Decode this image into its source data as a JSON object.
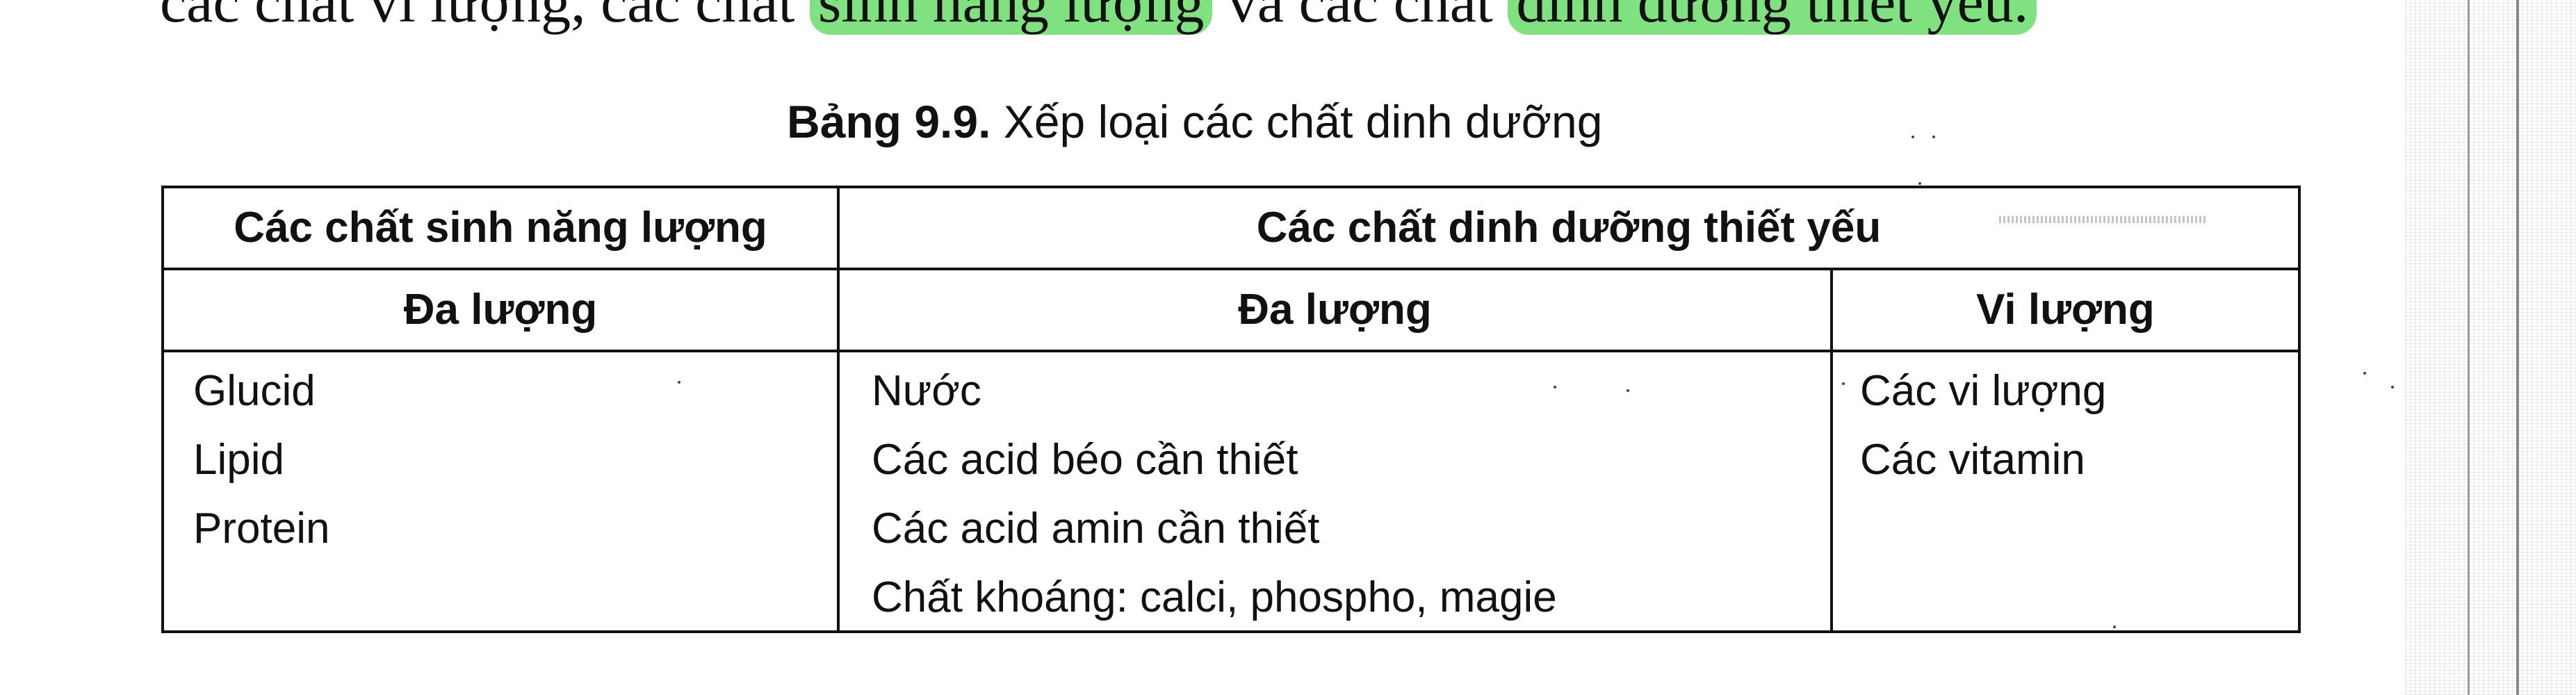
{
  "body_text": {
    "before_highlight_1": "các chất vi lượng, các chất ",
    "highlight_1": "sinh năng lượng",
    "between": " và các chất ",
    "highlight_2": "dinh dưỡng thiết yếu."
  },
  "caption": {
    "label": "Bảng 9.9.",
    "title": " Xếp loại các chất dinh dưỡng"
  },
  "table": {
    "group_headers": [
      "Các chất sinh năng lượng",
      "Các chất dinh dưỡng thiết yếu"
    ],
    "sub_headers": [
      "Đa lượng",
      "Đa lượng",
      "Vi lượng"
    ],
    "columns": [
      [
        "Glucid",
        "Lipid",
        "Protein"
      ],
      [
        "Nước",
        "Các acid béo cần thiết",
        "Các acid amin cần thiết",
        "Chất khoáng: calci, phospho, magie"
      ],
      [
        "Các vi lượng",
        "Các vitamin"
      ]
    ]
  },
  "colors": {
    "highlight": "#7fe17f",
    "text": "#111111"
  }
}
